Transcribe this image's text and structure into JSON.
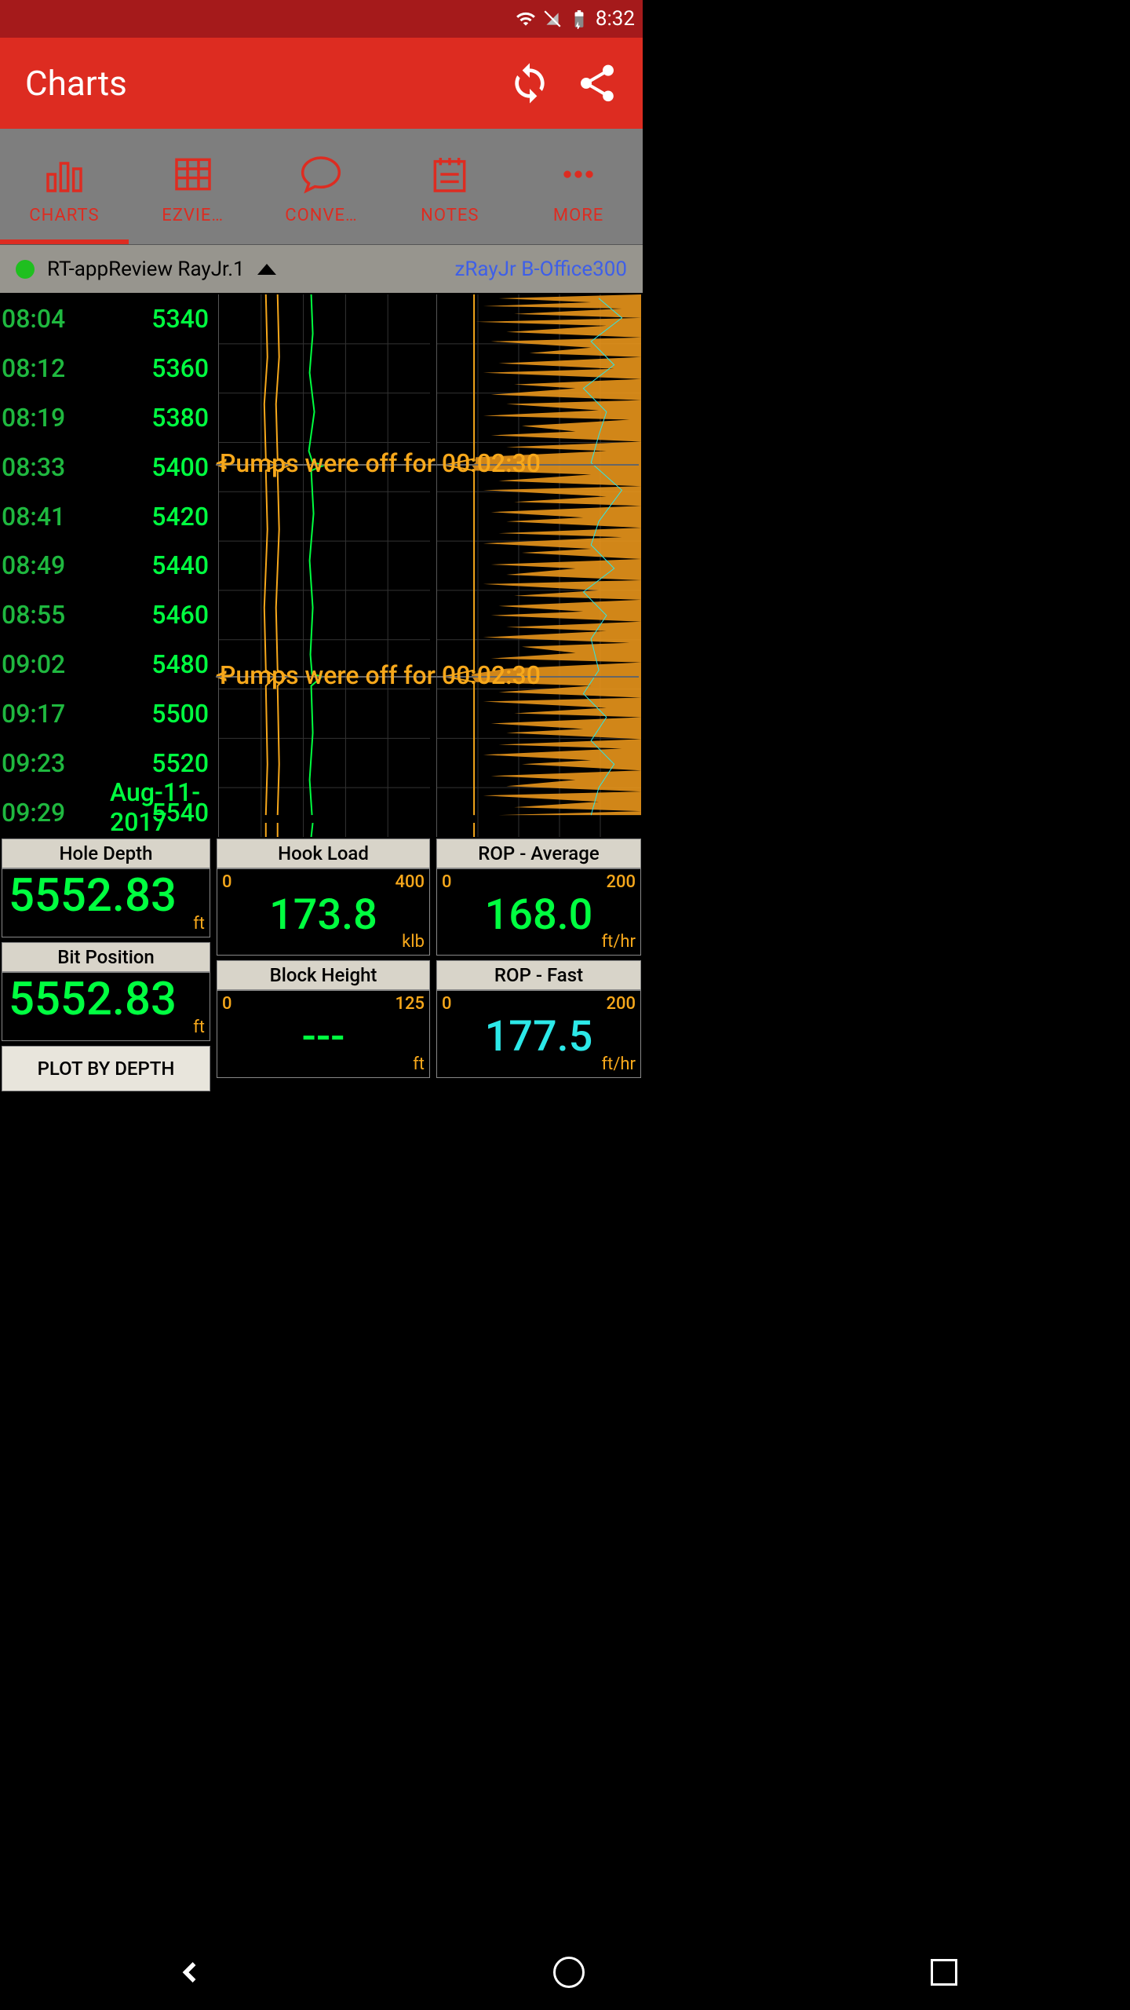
{
  "status_bar": {
    "time": "8:32"
  },
  "app": {
    "title": "Charts"
  },
  "tabs": [
    {
      "label": "CHARTS",
      "active": true
    },
    {
      "label": "EZVIE…"
    },
    {
      "label": "CONVE…"
    },
    {
      "label": "NOTES"
    },
    {
      "label": "MORE"
    }
  ],
  "info": {
    "well": "RT-appReview RayJr.1",
    "user": "zRayJr B-Office300"
  },
  "chart_data": {
    "type": "depth_log",
    "date": "Aug-11-2017",
    "time_axis": [
      "08:04",
      "08:12",
      "08:19",
      "08:33",
      "08:41",
      "08:49",
      "08:55",
      "09:02",
      "09:17",
      "09:23",
      "09:29"
    ],
    "depth_axis": [
      5340,
      5360,
      5380,
      5400,
      5420,
      5440,
      5460,
      5480,
      5500,
      5520,
      5540
    ],
    "annotations": [
      {
        "text": "Pumps were off for 00:02:30",
        "row": 3
      },
      {
        "text": "Pumps were off for 00:02:30",
        "row": 8
      }
    ],
    "tracks": [
      {
        "name": "Hook Load",
        "color": "yellow"
      },
      {
        "name": "Bit Position / Block Height",
        "color": "green"
      },
      {
        "name": "ROP",
        "color": "orange-fill"
      },
      {
        "name": "ROP overlay",
        "color": "cyan"
      }
    ]
  },
  "panels": {
    "hole_depth": {
      "label": "Hole Depth",
      "value": "5552.83",
      "unit": "ft"
    },
    "bit_position": {
      "label": "Bit Position",
      "value": "5552.83",
      "unit": "ft"
    },
    "plot_button": "PLOT BY DEPTH",
    "hook_load": {
      "label": "Hook Load",
      "min": "0",
      "max": "400",
      "value": "173.8",
      "unit": "klb"
    },
    "block_height": {
      "label": "Block Height",
      "min": "0",
      "max": "125",
      "value": "---",
      "unit": "ft"
    },
    "rop_avg": {
      "label": "ROP - Average",
      "min": "0",
      "max": "200",
      "value": "168.0",
      "unit": "ft/hr"
    },
    "rop_fast": {
      "label": "ROP - Fast",
      "min": "0",
      "max": "200",
      "value": "177.5",
      "unit": "ft/hr"
    }
  }
}
